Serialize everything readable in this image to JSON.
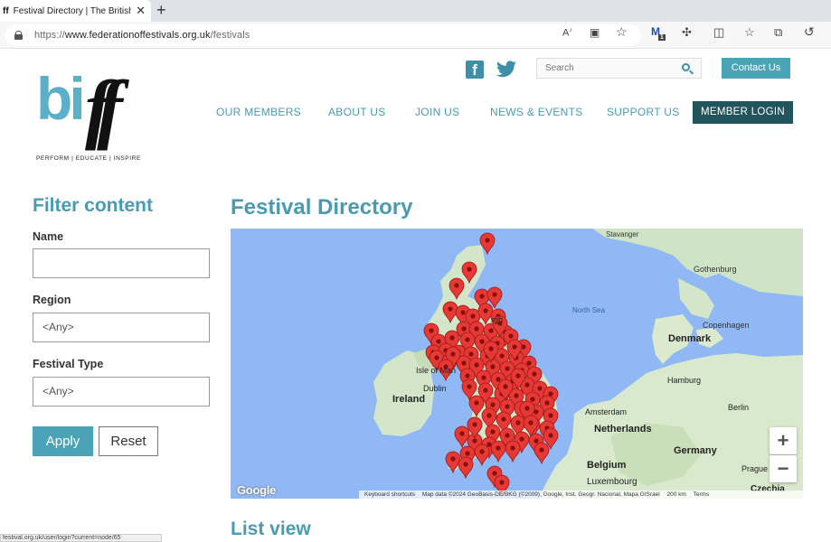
{
  "browser": {
    "tab_title": "Festival Directory | The British and",
    "tab_favicon": "ff",
    "url_scheme": "https://",
    "url_host": "www.federationoffestivals.org.uk",
    "url_path": "/festivals",
    "extension_badge": "1",
    "status_url": "festival.org.uk/user/login?current=node/65"
  },
  "site": {
    "logo_bi": "bi",
    "logo_ff": "ff",
    "tagline": "PERFORM | EDUCATE | INSPIRE",
    "search_placeholder": "Search",
    "contact_label": "Contact Us",
    "nav": [
      "OUR MEMBERS",
      "ABOUT US",
      "JOIN US",
      "NEWS & EVENTS",
      "SUPPORT US"
    ],
    "login_label": "MEMBER LOGIN"
  },
  "filter": {
    "heading": "Filter content",
    "name_label": "Name",
    "name_value": "",
    "region_label": "Region",
    "region_value": "<Any>",
    "type_label": "Festival Type",
    "type_value": "<Any>",
    "apply_label": "Apply",
    "reset_label": "Reset"
  },
  "main": {
    "title": "Festival Directory",
    "list_heading": "List view"
  },
  "map": {
    "labels": {
      "stavanger": "Stavanger",
      "gothenburg": "Gothenburg",
      "north_sea": "North Sea",
      "copenhagen": "Copenhagen",
      "denmark": "Denmark",
      "isle_of_man": "Isle of Man",
      "dublin": "Dublin",
      "ireland": "Ireland",
      "hamburg": "Hamburg",
      "amsterdam": "Amsterdam",
      "netherlands": "Netherlands",
      "berlin": "Berlin",
      "germany": "Germany",
      "belgium": "Belgium",
      "luxembourg": "Luxembourg",
      "prague": "Prague",
      "czechia": "Czechia",
      "edinburgh_fragment": "rgh"
    },
    "zoom_in": "+",
    "zoom_out": "−",
    "google": "Google",
    "keyboard_shortcuts": "Keyboard shortcuts",
    "attribution": "Map data ©2024 GeoBasis-DE/BKG (©2009), Google, Inst. Geogr. Nacional, Mapa GISrael",
    "scale": "200 km",
    "terms": "Terms"
  }
}
